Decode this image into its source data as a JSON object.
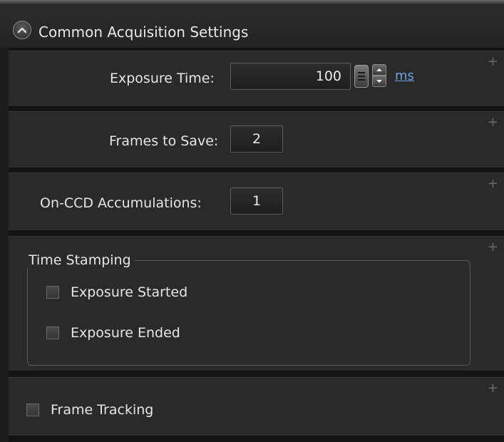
{
  "header": {
    "title": "Common Acquisition Settings",
    "collapse_icon": "chevron-up-icon"
  },
  "exposure": {
    "label": "Exposure Time:",
    "value": "100",
    "unit": "ms"
  },
  "frames": {
    "label": "Frames to Save:",
    "value": "2"
  },
  "accumulations": {
    "label": "On-CCD Accumulations:",
    "value": "1"
  },
  "time_stamping": {
    "title": "Time Stamping",
    "options": [
      {
        "label": "Exposure Started",
        "checked": false
      },
      {
        "label": "Exposure Ended",
        "checked": false
      }
    ]
  },
  "frame_tracking": {
    "label": "Frame Tracking",
    "checked": false
  },
  "panel_expand_symbol": "+",
  "colors": {
    "background": "#1c1c1c",
    "panel": "#2a2a2a",
    "link": "#6fa3e0",
    "text": "#e6e6e6"
  }
}
